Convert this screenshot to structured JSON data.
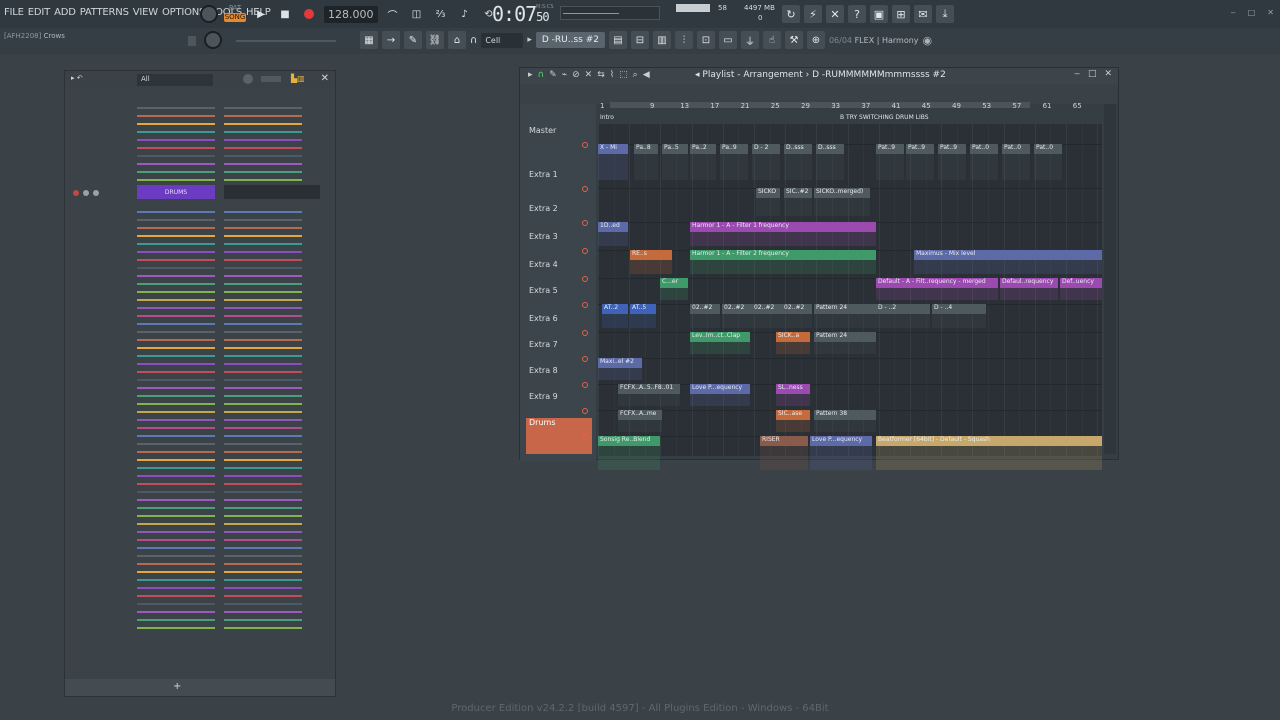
{
  "menu": [
    "FILE",
    "EDIT",
    "ADD",
    "PATTERNS",
    "VIEW",
    "OPTIONS",
    "TOOLS",
    "HELP"
  ],
  "transport": {
    "pat_label": "PAT",
    "song_label": "SONG",
    "tempo": "128.000",
    "time": "0:07",
    "time_sub": "50",
    "time_label": "M:S:CS",
    "meter_value": "58",
    "memory": "4497 MB",
    "memory_sub": "0"
  },
  "hint": {
    "code": "[AFH2208]",
    "text": "Crows"
  },
  "toolbar2": {
    "snap": "Cell",
    "pattern": "D -RU..ss #2",
    "harmony_count": "06/04",
    "harmony_name": "FLEX | Harmony"
  },
  "rack": {
    "filter": "All",
    "drums_label": "DRUMS",
    "add_label": "+"
  },
  "playlist": {
    "title": "Playlist - Arrangement",
    "pattern": "D -RUMMMMMMmmmssss #2",
    "ruler": [
      "1",
      "9",
      "13",
      "17",
      "21",
      "25",
      "29",
      "33",
      "37",
      "41",
      "45",
      "49",
      "53",
      "57",
      "61",
      "65"
    ],
    "marker_intro": "Intro",
    "marker_try": "B TRY SWITCHING DRUM LIBS",
    "tracks": [
      "Master",
      "Extra 1",
      "Extra 2",
      "Extra 3",
      "Extra 4",
      "Extra 5",
      "Extra 6",
      "Extra 7",
      "Extra 8",
      "Extra 9",
      "Drums"
    ],
    "clips": [
      {
        "label": "X - Mi",
        "color": "#5c6aa8"
      },
      {
        "label": "Pa..8",
        "color": "#4f5960"
      },
      {
        "label": "Pa..5",
        "color": "#4f5960"
      },
      {
        "label": "Pa..2",
        "color": "#4f5960"
      },
      {
        "label": "Pa..9",
        "color": "#4f5960"
      },
      {
        "label": "D - 2",
        "color": "#4f5960"
      },
      {
        "label": "D..sss",
        "color": "#4f5960"
      },
      {
        "label": "D..sss",
        "color": "#4f5960"
      },
      {
        "label": "Pat..9",
        "color": "#4f5960"
      },
      {
        "label": "Pat..9",
        "color": "#4f5960"
      },
      {
        "label": "Pat..9",
        "color": "#4f5960"
      },
      {
        "label": "Pat..0",
        "color": "#4f5960"
      },
      {
        "label": "Pat..0",
        "color": "#4f5960"
      },
      {
        "label": "Pat..0",
        "color": "#4f5960"
      },
      {
        "label": "SICKO",
        "color": "#4f5960"
      },
      {
        "label": "SIC..#2",
        "color": "#4f5960"
      },
      {
        "label": "SICKO..merged)",
        "color": "#4f5960"
      },
      {
        "label": "1D..ed",
        "color": "#5c6aa8"
      },
      {
        "label": "Harmor 1 - A - Filter 1 frequency",
        "color": "#9b4ab0"
      },
      {
        "label": "RE..s",
        "color": "#c56a3a"
      },
      {
        "label": "Harmor 1 - A - Filter 2 frequency",
        "color": "#3f9a6a"
      },
      {
        "label": "Maximus - Mix level",
        "color": "#5c6aa8"
      },
      {
        "label": "C...er",
        "color": "#3f9a6a"
      },
      {
        "label": "Default - A - Filt..requency - merged",
        "color": "#9b4ab0"
      },
      {
        "label": "Defaul..requency",
        "color": "#9b4ab0"
      },
      {
        "label": "Def..uency",
        "color": "#9b4ab0"
      },
      {
        "label": "AT..2",
        "color": "#3e63b8"
      },
      {
        "label": "AT..5",
        "color": "#3e63b8"
      },
      {
        "label": "02..#2",
        "color": "#4f5960"
      },
      {
        "label": "02..#2",
        "color": "#4f5960"
      },
      {
        "label": "02..#2",
        "color": "#4f5960"
      },
      {
        "label": "02..#2",
        "color": "#4f5960"
      },
      {
        "label": "Pattern 24",
        "color": "#4f5960"
      },
      {
        "label": "D - ..2",
        "color": "#4f5960"
      },
      {
        "label": "D - ..4",
        "color": "#4f5960"
      },
      {
        "label": "Lev..Im..ct..Clap",
        "color": "#3f9a6a"
      },
      {
        "label": "SICK..a",
        "color": "#c56a3a"
      },
      {
        "label": "Pattern 24",
        "color": "#4f5960"
      },
      {
        "label": "Maxi..el #2",
        "color": "#5c6aa8"
      },
      {
        "label": "FCFX..A..5..F8..01",
        "color": "#4f5960"
      },
      {
        "label": "Love P...equency",
        "color": "#5c6aa8"
      },
      {
        "label": "SL..ness",
        "color": "#9b4ab0"
      },
      {
        "label": "FCFX..A..me",
        "color": "#4f5960"
      },
      {
        "label": "SIC..ase",
        "color": "#c56a3a"
      },
      {
        "label": "Pattern 38",
        "color": "#4f5960"
      },
      {
        "label": "Sonsig Re..Blend",
        "color": "#3f9a6a"
      },
      {
        "label": "RISER",
        "color": "#8a5a4a"
      },
      {
        "label": "Love P...equency",
        "color": "#5c6aa8"
      },
      {
        "label": "Beatformer [64bit] - Default - Squash",
        "color": "#c8a86a"
      }
    ]
  },
  "footer": "Producer Edition v24.2.2 [build 4597] - All Plugins Edition - Windows - 64Bit"
}
